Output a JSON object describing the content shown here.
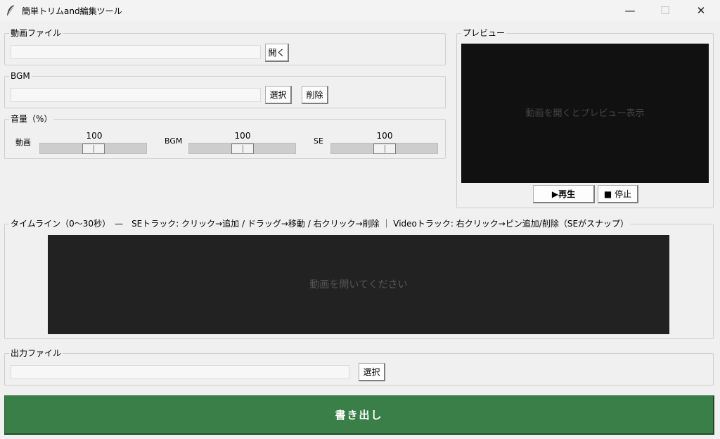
{
  "window": {
    "title": "簡単トリムand編集ツール",
    "minimize": "—",
    "maximize": "☐",
    "close": "✕"
  },
  "video_file": {
    "legend": "動画ファイル",
    "path_value": "",
    "open_label": "開く"
  },
  "bgm": {
    "legend": "BGM",
    "path_value": "",
    "select_label": "選択",
    "delete_label": "削除"
  },
  "volume": {
    "legend": "音量（%）",
    "video": {
      "label": "動画",
      "value": "100",
      "level": 1.0
    },
    "bgm": {
      "label": "BGM",
      "value": "100",
      "level": 1.0
    },
    "se": {
      "label": "SE",
      "value": "100",
      "level": 1.0
    }
  },
  "preview": {
    "legend": "プレビュー",
    "message": "動画を開くとプレビュー表示",
    "play_label": "▶再生",
    "stop_label": "■ 停止"
  },
  "timeline": {
    "legend": "タイムライン（0〜30秒）　—　SEトラック: クリック→追加 / ドラッグ→移動 / 右クリック→削除 ｜ Videoトラック: 右クリック→ピン追加/削除（SEがスナップ）",
    "message": "動画を開いてください"
  },
  "output": {
    "legend": "出力ファイル",
    "path_value": "",
    "select_label": "選択"
  },
  "export": {
    "label": "書き出し"
  },
  "colors": {
    "export_bg": "#3a7f47",
    "canvas_bg": "#111111",
    "timeline_bg": "#222222"
  }
}
